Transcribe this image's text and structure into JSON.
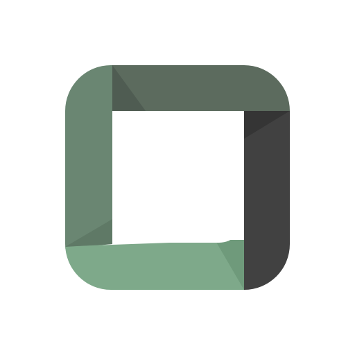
{
  "logo": {
    "icon": "rounded-square-frame-icon",
    "colors": {
      "background": "#ffffff",
      "left": "#6a8672",
      "top": "#5c6b5e",
      "right": "#414141",
      "bottom": "#7ea98a",
      "top_shadow": "#4f5c52",
      "right_shadow": "#353535",
      "bottom_shadow": "#6f9a7b",
      "left_shadow": "#5f7966"
    }
  }
}
